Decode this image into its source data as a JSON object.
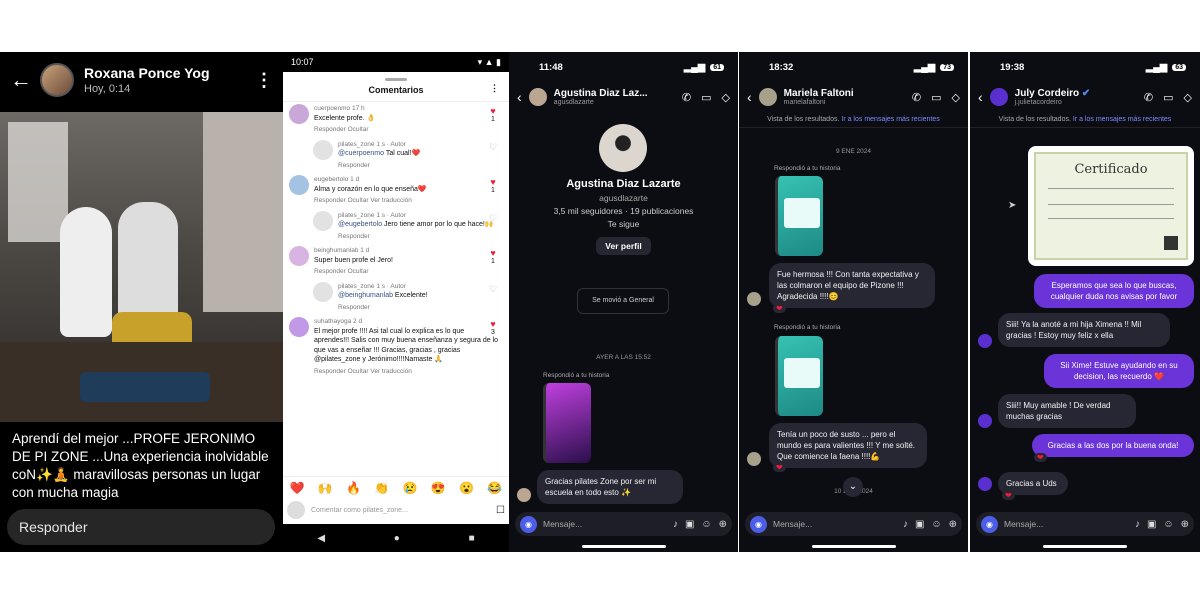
{
  "p1": {
    "name": "Roxana Ponce Yog",
    "time": "Hoy, 0:14",
    "caption": "Aprendí del mejor ...PROFE JERONIMO DE PI ZONE ...Una experiencia inolvidable coN✨🧘 maravillosas personas un lugar con mucha magia",
    "reply": "Responder"
  },
  "p2": {
    "status_time": "10:07",
    "title": "Comentarios",
    "comments": [
      {
        "user": "cuerpoenmo",
        "meta": "17 h",
        "text": "Excelente profe. 👌",
        "actions": "Responder   Ocultar",
        "likes": "1"
      },
      {
        "user": "pilates_zone",
        "meta": "1 s · Autor",
        "mention": "@cuerpoenmo",
        "text": " Tal cual!❤️",
        "actions": "Responder"
      },
      {
        "user": "eugebertolo",
        "meta": "1 d",
        "text": "Alma  y corazón en lo que enseña❤️",
        "actions": "Responder   Ocultar   Ver traducción",
        "likes": "1"
      },
      {
        "user": "pilates_zone",
        "meta": "1 s · Autor",
        "mention": "@eugebertolo",
        "text": " Jero tiene amor por lo que hace!🙌",
        "actions": "Responder"
      },
      {
        "user": "beinghumanlab",
        "meta": "1 d",
        "text": "Super buen profe el Jero!",
        "actions": "Responder   Ocultar",
        "likes": "1"
      },
      {
        "user": "pilates_zone",
        "meta": "1 s · Autor",
        "mention": "@beinghumanlab",
        "text": " Excelente!",
        "actions": "Responder"
      },
      {
        "user": "suhathayoga",
        "meta": "2 d",
        "text": "El mejor profe !!!! Asi tal cual lo explica es lo que aprendes!!! Salis con muy buena enseñanza y segura de lo que vas a enseñar !!! Gracias, gracias , gracias @pilates_zone y Jerónimo!!!!Namaste 🙏",
        "actions": "Responder   Ocultar   Ver traducción",
        "likes": "3"
      }
    ],
    "emojis": [
      "❤️",
      "🙌",
      "🔥",
      "👏",
      "😢",
      "😍",
      "😮",
      "😂"
    ],
    "input_placeholder": "Comentar como pilates_zone..."
  },
  "p3": {
    "time": "11:48",
    "battery": "61",
    "name": "Agustina Diaz Laz...",
    "handle": "agusdlazarte",
    "profile_name": "Agustina Diaz Lazarte",
    "profile_handle": "agusdlazarte",
    "profile_stats": "3,5 mil seguidores · 19 publicaciones",
    "profile_follow": "Te sigue",
    "view_profile": "Ver perfil",
    "moved": "Se movió a General",
    "sep": "AYER A LAS 15:52",
    "story_label": "Respondió a tu historia",
    "msg": "Gracias pilates Zone por ser mi escuela en todo esto ✨",
    "input": "Mensaje..."
  },
  "p4": {
    "time": "18:32",
    "battery": "73",
    "name": "Mariela Faltoni",
    "handle": "marielafaltoni",
    "note": "Vista de los resultados.",
    "note_link": "Ir a los mensajes más recientes",
    "sep": "9 ENE 2024",
    "story_label": "Respondió a tu historia",
    "msg1": "Fue hermosa !!! Con tanta expectativa y las colmaron el equipo de Pizone !!! Agradecida !!!!😊",
    "story_label2": "Respondió a tu historia",
    "msg2": "Tenía un poco de susto ... pero el mundo es para valientes !!! Y me solté. Que comience la faena !!!!💪",
    "sep2": "10 ENE 2024",
    "input": "Mensaje..."
  },
  "p5": {
    "time": "19:38",
    "battery": "63",
    "name": "July Cordeiro",
    "handle": "j.julietacordeiro",
    "note": "Vista de los resultados.",
    "note_link": "Ir a los mensajes más recientes",
    "cert_title": "Certificado",
    "mine1": "Esperamos que sea lo que buscas, cualquier duda nos avisas por favor",
    "their1": "Siii! Ya la anoté a mi hija Ximena !! Mil gracias ! Estoy muy feliz x ella",
    "mine2": "Sii Xime! Estuve ayudando en su decision, las recuerdo ❤️",
    "their2": "Siii!! Muy amable ! De verdad muchas gracias",
    "mine3": "Gracias a las dos por la buena onda!",
    "their3": "Gracias a Uds",
    "input": "Mensaje..."
  }
}
